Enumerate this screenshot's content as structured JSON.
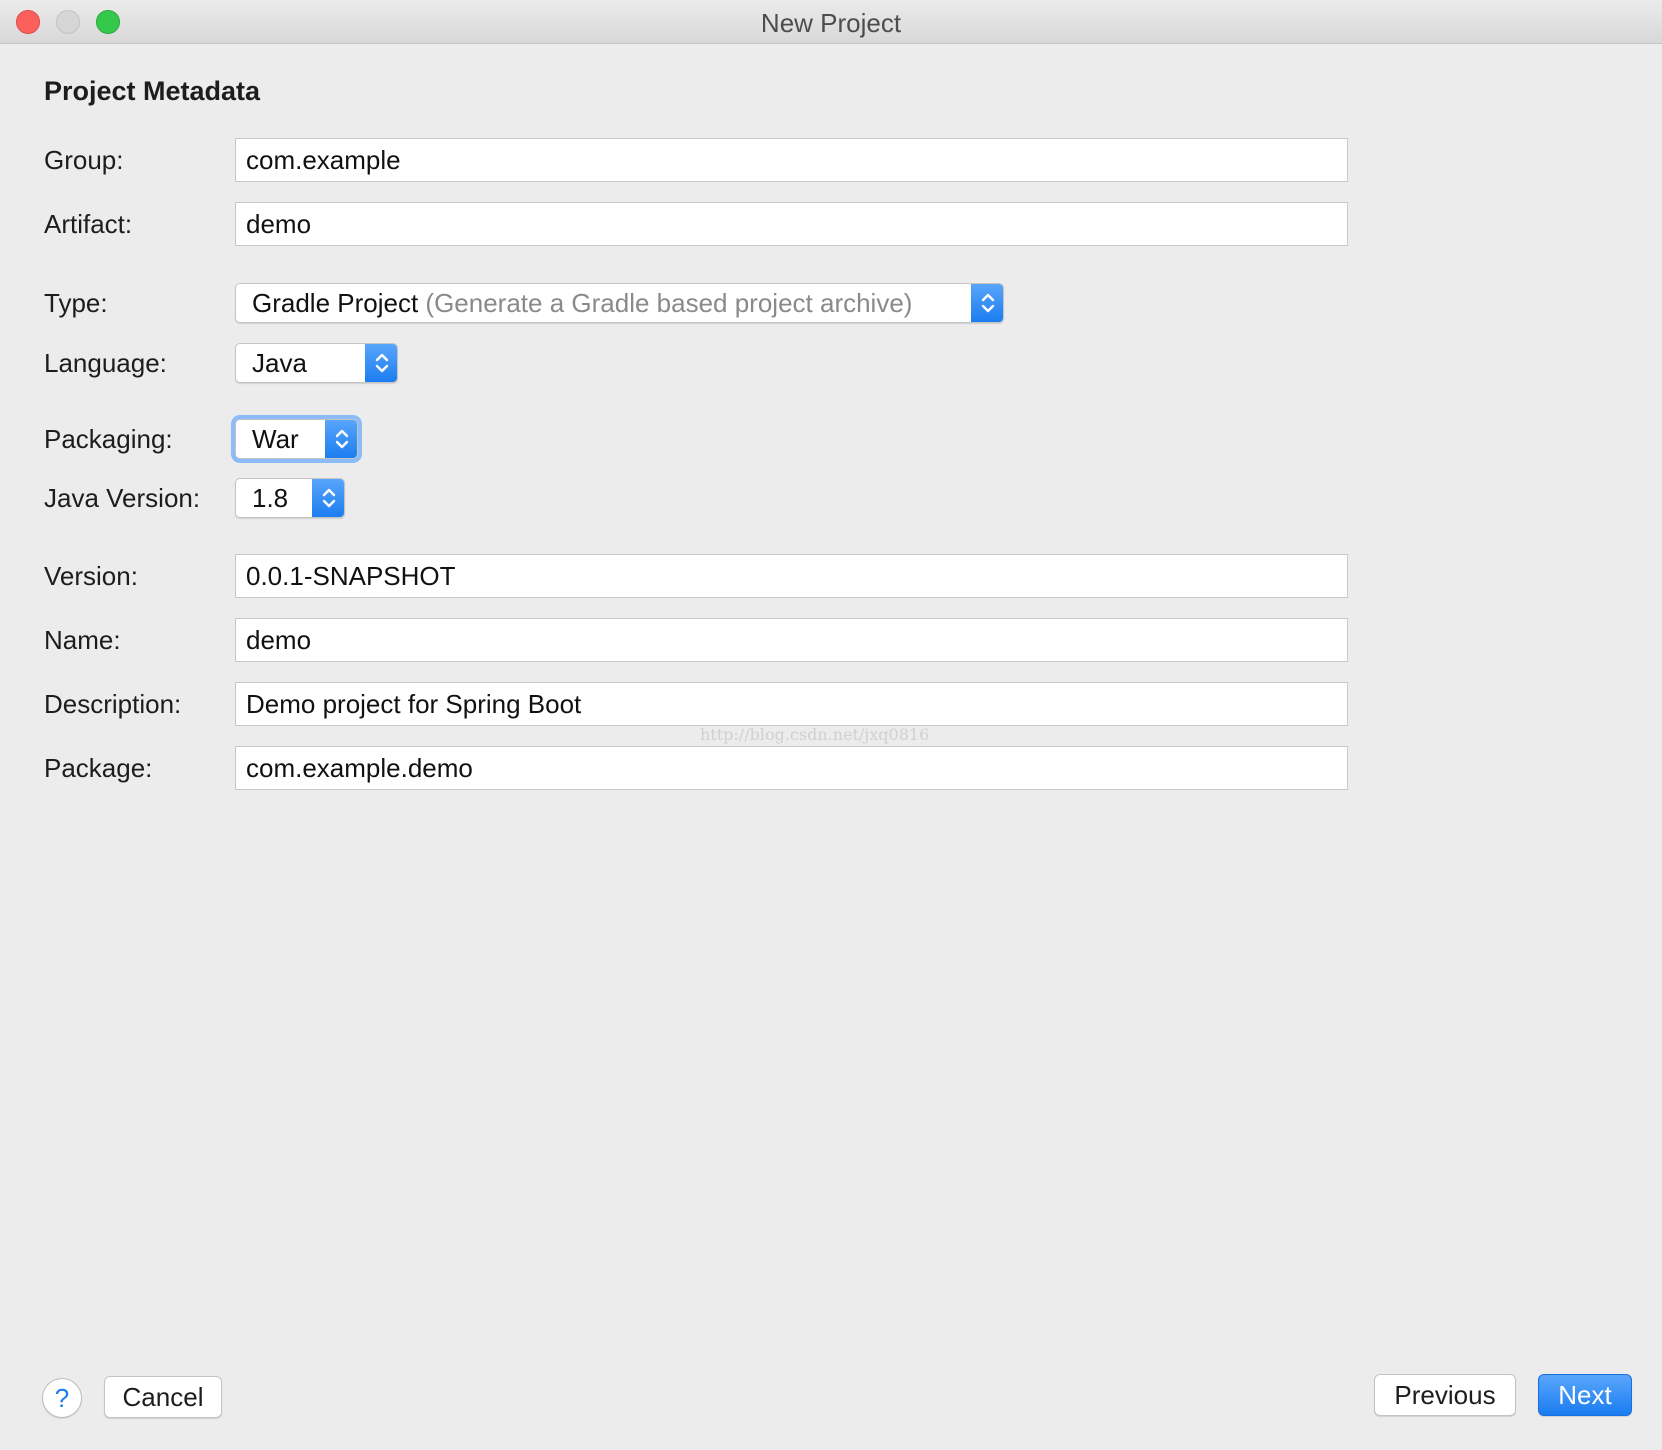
{
  "window": {
    "title": "New Project"
  },
  "section": {
    "title": "Project Metadata"
  },
  "fields": {
    "group": {
      "label": "Group:",
      "value": "com.example"
    },
    "artifact": {
      "label": "Artifact:",
      "value": "demo"
    },
    "type": {
      "label": "Type:",
      "value": "Gradle Project",
      "hint": "(Generate a Gradle based project archive)"
    },
    "language": {
      "label": "Language:",
      "value": "Java"
    },
    "packaging": {
      "label": "Packaging:",
      "value": "War"
    },
    "java_version": {
      "label": "Java Version:",
      "value": "1.8"
    },
    "version": {
      "label": "Version:",
      "value": "0.0.1-SNAPSHOT"
    },
    "name": {
      "label": "Name:",
      "value": "demo"
    },
    "description": {
      "label": "Description:",
      "value": "Demo project for Spring Boot"
    },
    "package": {
      "label": "Package:",
      "value": "com.example.demo"
    }
  },
  "watermark": "http://blog.csdn.net/jxq0816",
  "buttons": {
    "help": "?",
    "cancel": "Cancel",
    "previous": "Previous",
    "next": "Next"
  },
  "colors": {
    "accent": "#1a7cf0",
    "close": "#fc605c",
    "minimize": "#d6d6d6",
    "maximize": "#34c84a"
  }
}
